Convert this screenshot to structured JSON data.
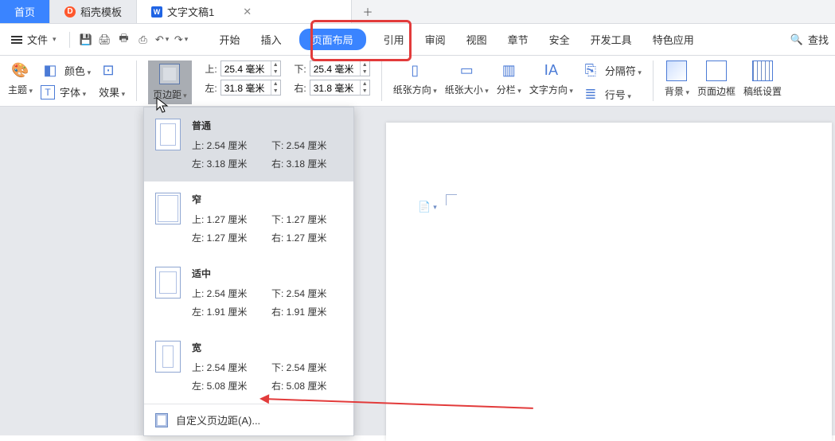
{
  "tabs": {
    "home": "首页",
    "daoke": "稻壳模板",
    "doc": "文字文稿1"
  },
  "menu": {
    "file": "文件",
    "items": [
      "开始",
      "插入",
      "页面布局",
      "引用",
      "审阅",
      "视图",
      "章节",
      "安全",
      "开发工具",
      "特色应用"
    ],
    "active_index": 2,
    "find": "查找"
  },
  "ribbon": {
    "theme": "主题",
    "color": "颜色",
    "font": "字体",
    "effect": "效果",
    "margins_btn": "页边距",
    "top_label": "上:",
    "top_val": "25.4 毫米",
    "bottom_label": "下:",
    "bottom_val": "25.4 毫米",
    "left_label": "左:",
    "left_val": "31.8 毫米",
    "right_label": "右:",
    "right_val": "31.8 毫米",
    "orientation": "纸张方向",
    "size": "纸张大小",
    "columns": "分栏",
    "textdir": "文字方向",
    "breaks": "分隔符",
    "linenum": "行号",
    "background": "背景",
    "pageborder": "页面边框",
    "manuscript": "稿纸设置"
  },
  "marginMenu": {
    "items": [
      {
        "title": "普通",
        "top": "上: 2.54 厘米",
        "bottom": "下: 2.54 厘米",
        "left": "左: 3.18 厘米",
        "right": "右: 3.18 厘米",
        "thumb": "normal",
        "selected": true
      },
      {
        "title": "窄",
        "top": "上: 1.27 厘米",
        "bottom": "下: 1.27 厘米",
        "left": "左: 1.27 厘米",
        "right": "右: 1.27 厘米",
        "thumb": "narrow",
        "selected": false
      },
      {
        "title": "适中",
        "top": "上: 2.54 厘米",
        "bottom": "下: 2.54 厘米",
        "left": "左: 1.91 厘米",
        "right": "右: 1.91 厘米",
        "thumb": "moderate",
        "selected": false
      },
      {
        "title": "宽",
        "top": "上: 2.54 厘米",
        "bottom": "下: 2.54 厘米",
        "left": "左: 5.08 厘米",
        "right": "右: 5.08 厘米",
        "thumb": "wide",
        "selected": false
      }
    ],
    "custom": "自定义页边距(A)..."
  }
}
